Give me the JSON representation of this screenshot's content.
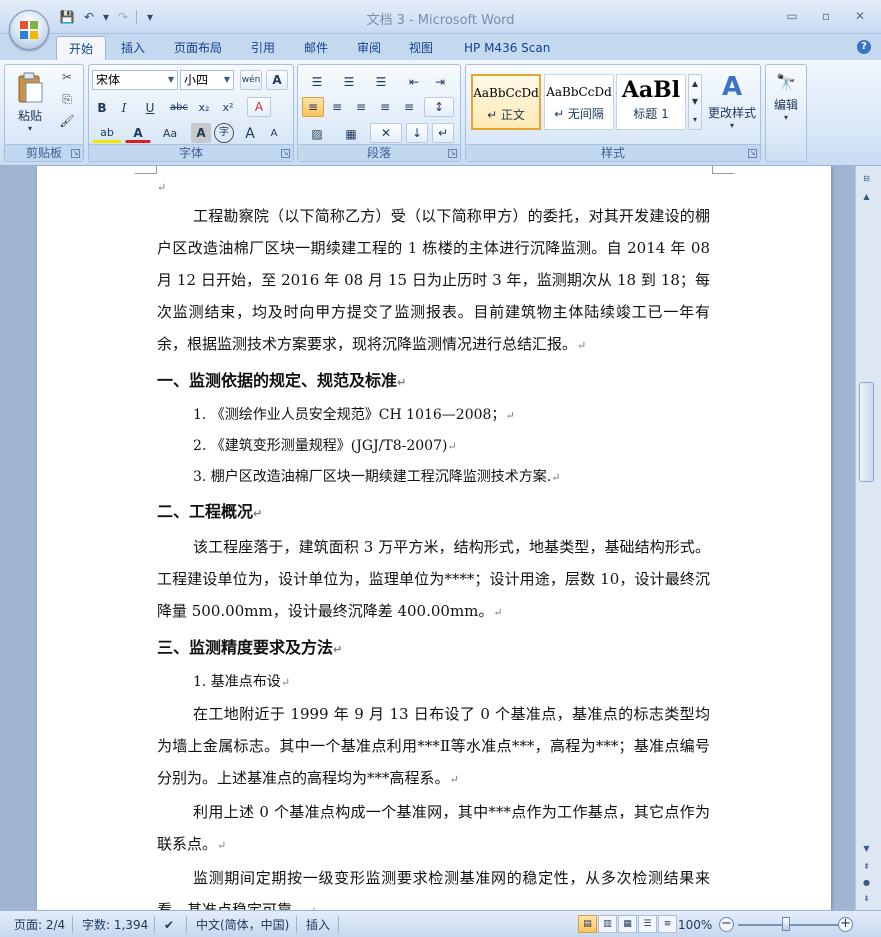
{
  "window": {
    "title": "文档 3 - Microsoft Word",
    "controls": {
      "minimize": "▭",
      "maximize": "▫",
      "close": "✕"
    }
  },
  "qat": {
    "save": "💾",
    "undo": "↶",
    "undo_drop": "▾",
    "redo": "↷",
    "customize": "▾"
  },
  "tabs": [
    "开始",
    "插入",
    "页面布局",
    "引用",
    "邮件",
    "审阅",
    "视图",
    "HP M436 Scan"
  ],
  "help": "?",
  "ribbon": {
    "clipboard": {
      "label": "剪贴板",
      "paste": "粘贴",
      "paste_drop": "▾",
      "cut": "✂",
      "copy": "⎘",
      "format_painter": "🖌"
    },
    "font": {
      "label": "字体",
      "font_name": "宋体",
      "font_size": "小四",
      "phonetic": "wén",
      "char_border": "A",
      "bold": "B",
      "italic": "I",
      "underline": "U",
      "strike": "abc",
      "sub": "x₂",
      "sup": "x²",
      "clear": "A",
      "highlight": "ab",
      "color": "A",
      "change_case": "Aa",
      "char_shading": "A",
      "enclose": "字",
      "grow": "A",
      "shrink": "A"
    },
    "paragraph": {
      "label": "段落",
      "bullets": "☰",
      "numbering": "☰",
      "multilevel": "☰",
      "dec_indent": "⇤",
      "inc_indent": "⇥",
      "chinese_layout": "✕",
      "align_left": "≡",
      "center": "≡",
      "align_right": "≡",
      "justify": "≡",
      "distributed": "≡",
      "line_spacing": "↕",
      "shading": "▨",
      "borders": "▦",
      "sort": "↓",
      "show_marks": "↵"
    },
    "styles": {
      "label": "样式",
      "items": [
        {
          "sample": "AaBbCcDd",
          "name": "↵ 正文"
        },
        {
          "sample": "AaBbCcDd",
          "name": "↵ 无间隔"
        },
        {
          "sample": "AaBl",
          "name": "标题 1"
        }
      ],
      "change_styles": "更改样式",
      "change_icon": "A"
    },
    "editing": {
      "label": "编辑",
      "icon": "🔭"
    }
  },
  "document": {
    "p1": "工程勘察院（以下简称乙方）受（以下简称甲方）的委托，对其开发建设的棚户区改造油棉厂区块一期续建工程的 1 栋楼的主体进行沉降监测。自 2014 年 08 月 12 日开始，至 2016 年 08 月 15 日为止历时 3 年，监测期次从 18 到 18；每次监测结束，均及时向甲方提交了监测报表。目前建筑物主体陆续竣工已一年有余，根据监测技术方案要求，现将沉降监测情况进行总结汇报。",
    "h1": "一、监测依据的规定、规范及标准",
    "list1": [
      "1. 《测绘作业人员安全规范》CH 1016—2008；",
      "2. 《建筑变形测量规程》(JGJ/T8-2007)",
      "3. 棚户区改造油棉厂区块一期续建工程沉降监测技术方案."
    ],
    "h2": "二、工程概况",
    "p2": "该工程座落于，建筑面积 3 万平方米，结构形式，地基类型，基础结构形式。工程建设单位为，设计单位为，监理单位为****；设计用途，层数 10，设计最终沉降量 500.00mm，设计最终沉降差 400.00mm。",
    "h3": "三、监测精度要求及方法",
    "sub1": "1. 基准点布设",
    "p3": "在工地附近于 1999 年 9 月 13 日布设了 0 个基准点，基准点的标志类型均为墙上金属标志。其中一个基准点利用***Ⅱ等水准点***，高程为***；基准点编号分别为。上述基准点的高程均为***高程系。",
    "p4": "利用上述 0 个基准点构成一个基准网，其中***点作为工作基点，其它点作为联系点。",
    "p5": "监测期间定期按一级变形监测要求检测基准网的稳定性，从多次检测结果来看，基准点稳定可靠。",
    "para_mark": "↵"
  },
  "status": {
    "page": "页面: 2/4",
    "words": "字数: 1,394",
    "lang": "中文(简体，中国)",
    "mode": "插入",
    "zoom": "100%",
    "zoom_minus": "−",
    "zoom_plus": "+"
  },
  "colors": {
    "accent": "#15428b",
    "ribbon": "#d9e7f7",
    "doc_bg": "#9fb5d2"
  }
}
